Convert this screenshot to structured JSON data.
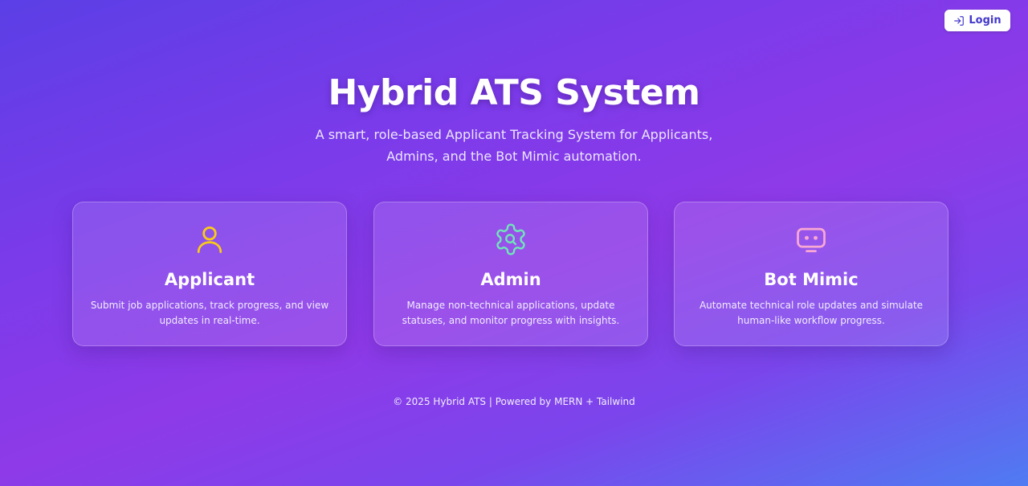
{
  "header": {
    "login_label": "Login"
  },
  "hero": {
    "title": "Hybrid ATS System",
    "subtitle": "A smart, role-based Applicant Tracking System for Applicants, Admins, and the Bot Mimic automation."
  },
  "cards": [
    {
      "icon": "user-icon",
      "title": "Applicant",
      "description": "Submit job applications, track progress, and view updates in real-time.",
      "icon_color": "#facc15"
    },
    {
      "icon": "gear-icon",
      "title": "Admin",
      "description": "Manage non-technical applications, update statuses, and monitor progress with insights.",
      "icon_color": "#6ee7b7"
    },
    {
      "icon": "bot-icon",
      "title": "Bot Mimic",
      "description": "Automate technical role updates and simulate human-like workflow progress.",
      "icon_color": "#f9a8d4"
    }
  ],
  "footer": {
    "text": "© 2025 Hybrid ATS | Powered by MERN + Tailwind"
  },
  "colors": {
    "login_text": "#4338ca",
    "background_start": "#5b3fe6",
    "background_end": "#4f7bf2"
  }
}
